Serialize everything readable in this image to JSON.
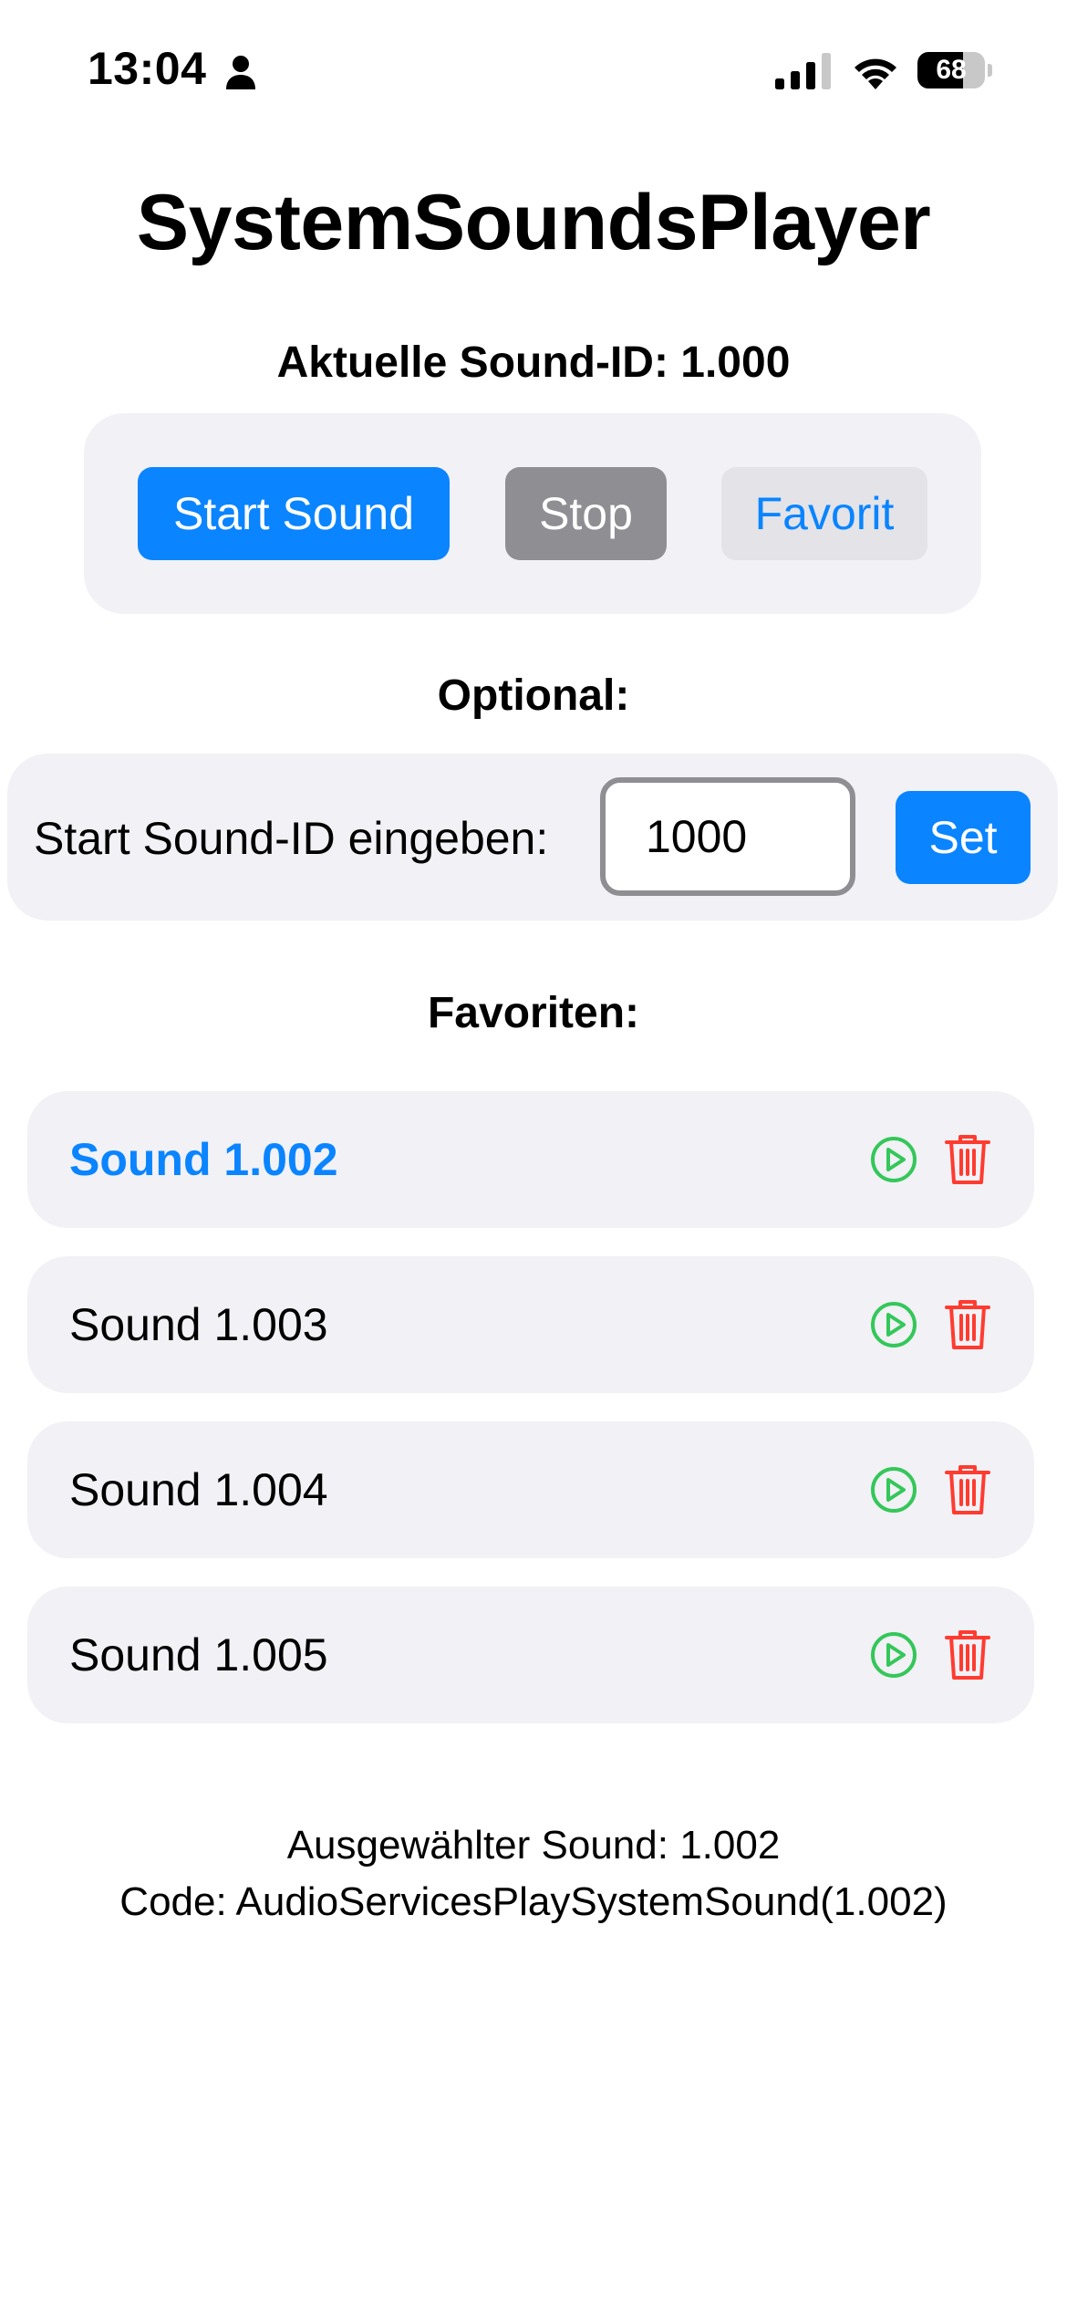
{
  "status_bar": {
    "time": "13:04",
    "battery_percent": "68",
    "battery_level": 0.68
  },
  "app": {
    "title": "SystemSoundsPlayer",
    "current_sound_label": "Aktuelle Sound-ID: 1.000"
  },
  "controls": {
    "start_label": "Start Sound",
    "stop_label": "Stop",
    "favorite_label": "Favorit"
  },
  "optional": {
    "heading": "Optional:",
    "input_label": "Start Sound-ID eingeben:",
    "input_value": "1000",
    "set_label": "Set"
  },
  "favorites": {
    "heading": "Favoriten:",
    "items": [
      {
        "label": "Sound 1.002",
        "selected": true
      },
      {
        "label": "Sound 1.003",
        "selected": false
      },
      {
        "label": "Sound 1.004",
        "selected": false
      },
      {
        "label": "Sound 1.005",
        "selected": false
      }
    ]
  },
  "footer": {
    "selected_text": "Ausgewählter Sound: 1.002",
    "code_text": "Code: AudioServicesPlaySystemSound(1.002)"
  },
  "colors": {
    "accent": "#0a84ff",
    "play": "#34c759",
    "delete": "#ff3b30",
    "card": "#f1f1f6"
  },
  "icons": {
    "play": "play-circle-icon",
    "delete": "trash-icon"
  }
}
